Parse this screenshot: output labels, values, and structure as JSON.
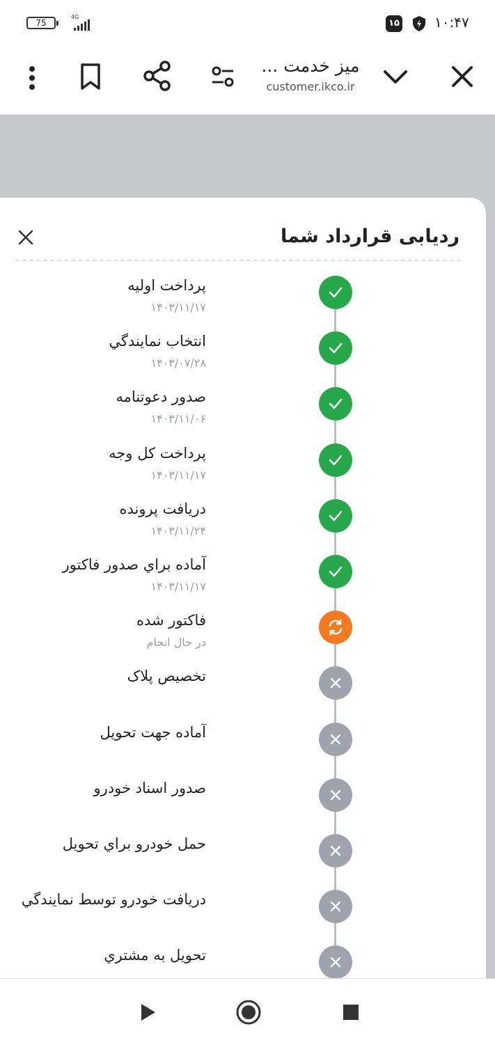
{
  "status_bar": {
    "battery": "75",
    "network": "4G",
    "sim_badge": "۱۵",
    "time": "۱۰:۴۷",
    "icons": [
      "battery-icon",
      "signal-icon",
      "sim-icon",
      "shield-icon"
    ]
  },
  "browser": {
    "title": "میز خدمت ...",
    "url": "customer.ikco.ir",
    "icons": [
      "close-icon",
      "chevron-down-icon",
      "site-settings-icon",
      "share-icon",
      "bookmark-icon",
      "more-icon"
    ]
  },
  "sheet": {
    "title": "ردیابی قرارداد شما",
    "steps": [
      {
        "label": "پرداخت اولیه",
        "sub": "۱۴۰۳/۱۱/۱۷",
        "status": "done"
      },
      {
        "label": "انتخاب نمایندگي",
        "sub": "۱۴۰۳/۰۷/۲۸",
        "status": "done"
      },
      {
        "label": "صدور دعوتنامه",
        "sub": "۱۴۰۳/۱۱/۰۶",
        "status": "done"
      },
      {
        "label": "پرداخت کل وجه",
        "sub": "۱۴۰۳/۱۱/۱۷",
        "status": "done"
      },
      {
        "label": "دریافت پرونده",
        "sub": "۱۴۰۳/۱۱/۲۴",
        "status": "done"
      },
      {
        "label": "آماده براي صدور فاکتور",
        "sub": "۱۴۰۳/۱۱/۱۷",
        "status": "done"
      },
      {
        "label": "فاکتور شده",
        "sub": "در حال انجام",
        "status": "progress"
      },
      {
        "label": "تخصیص پلاک",
        "sub": "",
        "status": "pending"
      },
      {
        "label": "آماده جهت تحویل",
        "sub": "",
        "status": "pending"
      },
      {
        "label": "صدور اسناد خودرو",
        "sub": "",
        "status": "pending"
      },
      {
        "label": "حمل خودرو براي تحویل",
        "sub": "",
        "status": "pending"
      },
      {
        "label": "دریافت خودرو توسط نمایندگي",
        "sub": "",
        "status": "pending"
      },
      {
        "label": "تحویل به مشتري",
        "sub": "",
        "status": "pending"
      }
    ],
    "colors": {
      "done": "#27a84a",
      "progress": "#f47a20",
      "pending": "#9ea3ad"
    }
  },
  "navbar": {
    "icons": [
      "play-icon",
      "record-icon",
      "stop-icon"
    ]
  }
}
